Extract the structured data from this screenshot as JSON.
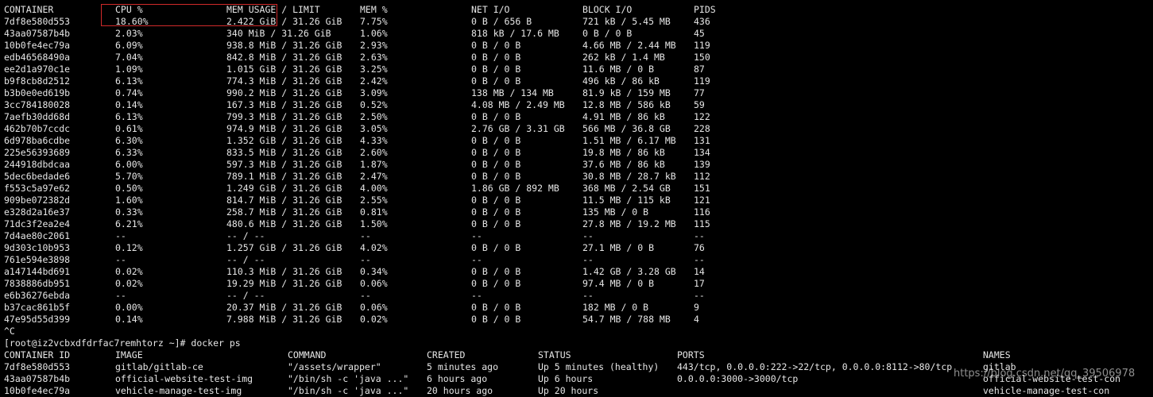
{
  "stats": {
    "headers": [
      "CONTAINER",
      "CPU %",
      "MEM USAGE / LIMIT",
      "MEM %",
      "NET I/O",
      "BLOCK I/O",
      "PIDS"
    ],
    "rows": [
      [
        "7df8e580d553",
        "18.60%",
        "2.422 GiB / 31.26 GiB",
        "7.75%",
        "0 B / 656 B",
        "721 kB / 5.45 MB",
        "436"
      ],
      [
        "43aa07587b4b",
        "2.03%",
        "340 MiB / 31.26 GiB",
        "1.06%",
        "818 kB / 17.6 MB",
        "0 B / 0 B",
        "45"
      ],
      [
        "10b0fe4ec79a",
        "6.09%",
        "938.8 MiB / 31.26 GiB",
        "2.93%",
        "0 B / 0 B",
        "4.66 MB / 2.44 MB",
        "119"
      ],
      [
        "edb46568490a",
        "7.04%",
        "842.8 MiB / 31.26 GiB",
        "2.63%",
        "0 B / 0 B",
        "262 kB / 1.4 MB",
        "150"
      ],
      [
        "ee2d1a970c1e",
        "1.09%",
        "1.015 GiB / 31.26 GiB",
        "3.25%",
        "0 B / 0 B",
        "11.6 MB / 0 B",
        "87"
      ],
      [
        "b9f8cb8d2512",
        "6.13%",
        "774.3 MiB / 31.26 GiB",
        "2.42%",
        "0 B / 0 B",
        "496 kB / 86 kB",
        "119"
      ],
      [
        "b3b0e0ed619b",
        "0.74%",
        "990.2 MiB / 31.26 GiB",
        "3.09%",
        "138 MB / 134 MB",
        "81.9 kB / 159 MB",
        "77"
      ],
      [
        "3cc784180028",
        "0.14%",
        "167.3 MiB / 31.26 GiB",
        "0.52%",
        "4.08 MB / 2.49 MB",
        "12.8 MB / 586 kB",
        "59"
      ],
      [
        "7aefb30dd68d",
        "6.13%",
        "799.3 MiB / 31.26 GiB",
        "2.50%",
        "0 B / 0 B",
        "4.91 MB / 86 kB",
        "122"
      ],
      [
        "462b70b7ccdc",
        "0.61%",
        "974.9 MiB / 31.26 GiB",
        "3.05%",
        "2.76 GB / 3.31 GB",
        "566 MB / 36.8 GB",
        "228"
      ],
      [
        "6d978ba6cdbe",
        "6.30%",
        "1.352 GiB / 31.26 GiB",
        "4.33%",
        "0 B / 0 B",
        "1.51 MB / 6.17 MB",
        "131"
      ],
      [
        "225e56393689",
        "6.33%",
        "833.5 MiB / 31.26 GiB",
        "2.60%",
        "0 B / 0 B",
        "19.8 MB / 86 kB",
        "134"
      ],
      [
        "244918dbdcaa",
        "6.00%",
        "597.3 MiB / 31.26 GiB",
        "1.87%",
        "0 B / 0 B",
        "37.6 MB / 86 kB",
        "139"
      ],
      [
        "5dec6bedade6",
        "5.70%",
        "789.1 MiB / 31.26 GiB",
        "2.47%",
        "0 B / 0 B",
        "30.8 MB / 28.7 kB",
        "112"
      ],
      [
        "f553c5a97e62",
        "0.50%",
        "1.249 GiB / 31.26 GiB",
        "4.00%",
        "1.86 GB / 892 MB",
        "368 MB / 2.54 GB",
        "151"
      ],
      [
        "909be072382d",
        "1.60%",
        "814.7 MiB / 31.26 GiB",
        "2.55%",
        "0 B / 0 B",
        "11.5 MB / 115 kB",
        "121"
      ],
      [
        "e328d2a16e37",
        "0.33%",
        "258.7 MiB / 31.26 GiB",
        "0.81%",
        "0 B / 0 B",
        "135 MB / 0 B",
        "116"
      ],
      [
        "71dc3f2ea2e4",
        "6.21%",
        "480.6 MiB / 31.26 GiB",
        "1.50%",
        "0 B / 0 B",
        "27.8 MB / 19.2 MB",
        "115"
      ],
      [
        "7d4ae80c2061",
        "--",
        "-- / --",
        "--",
        "--",
        "--",
        "--"
      ],
      [
        "9d303c10b953",
        "0.12%",
        "1.257 GiB / 31.26 GiB",
        "4.02%",
        "0 B / 0 B",
        "27.1 MB / 0 B",
        "76"
      ],
      [
        "761e594e3898",
        "--",
        "-- / --",
        "--",
        "--",
        "--",
        "--"
      ],
      [
        "a147144bd691",
        "0.02%",
        "110.3 MiB / 31.26 GiB",
        "0.34%",
        "0 B / 0 B",
        "1.42 GB / 3.28 GB",
        "14"
      ],
      [
        "7838886db951",
        "0.02%",
        "19.29 MiB / 31.26 GiB",
        "0.06%",
        "0 B / 0 B",
        "97.4 MB / 0 B",
        "17"
      ],
      [
        "e6b36276ebda",
        "--",
        "-- / --",
        "--",
        "--",
        "--",
        "--"
      ],
      [
        "b37cac861b5f",
        "0.00%",
        "20.37 MiB / 31.26 GiB",
        "0.06%",
        "0 B / 0 B",
        "182 MB / 0 B",
        "9"
      ],
      [
        "47e95d55d399",
        "0.14%",
        "7.988 MiB / 31.26 GiB",
        "0.02%",
        "0 B / 0 B",
        "54.7 MB / 788 MB",
        "4"
      ]
    ]
  },
  "interrupt": "^C",
  "prompt": "[root@iz2vcbxdfdrfac7remhtorz ~]# docker ps",
  "ps": {
    "headers": [
      "CONTAINER ID",
      "IMAGE",
      "COMMAND",
      "CREATED",
      "STATUS",
      "PORTS",
      "NAMES"
    ],
    "rows": [
      [
        "7df8e580d553",
        "gitlab/gitlab-ce",
        "\"/assets/wrapper\"",
        "5 minutes ago",
        "Up 5 minutes (healthy)",
        "443/tcp, 0.0.0.0:222->22/tcp, 0.0.0.0:8112->80/tcp",
        "gitlab"
      ],
      [
        "43aa07587b4b",
        "official-website-test-img",
        "\"/bin/sh -c 'java ...\"",
        "6 hours ago",
        "Up 6 hours",
        "0.0.0.0:3000->3000/tcp",
        "official-website-test-con"
      ],
      [
        "10b0fe4ec79a",
        "vehicle-manage-test-img",
        "\"/bin/sh -c 'java ...\"",
        "20 hours ago",
        "Up 20 hours",
        "",
        "vehicle-manage-test-con"
      ]
    ]
  },
  "watermark": "https://blog.csdn.net/qq_39506978",
  "colors": {
    "background": "#000000",
    "text": "#e6e6e6",
    "highlight_border": "#d12a2a"
  }
}
